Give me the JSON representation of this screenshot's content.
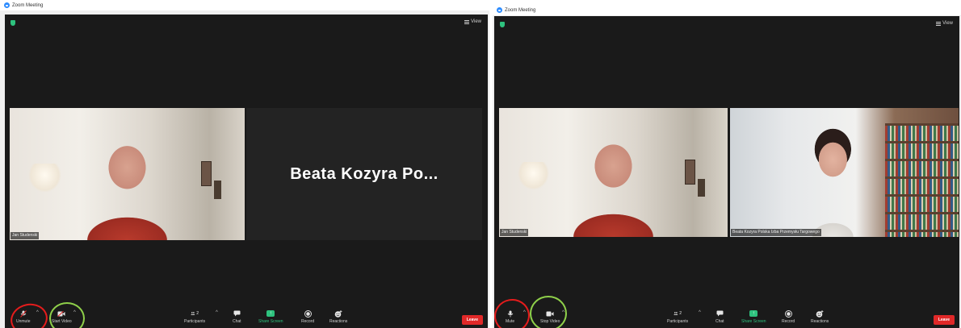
{
  "windows": [
    {
      "title": "Zoom Meeting",
      "view_label": "View",
      "tiles": [
        {
          "type": "video",
          "person": "jan",
          "name": "Jan Studenski"
        },
        {
          "type": "name-only",
          "name": "Beata Kozyra Po..."
        }
      ],
      "toolbar": {
        "mute": "Unmute",
        "video": "Start Video",
        "participants": "Participants",
        "participants_count": "2",
        "chat": "Chat",
        "share": "Share Screen",
        "record": "Record",
        "reactions": "Reactions",
        "leave": "Leave"
      }
    },
    {
      "title": "Zoom Meeting",
      "view_label": "View",
      "tiles": [
        {
          "type": "video",
          "person": "jan",
          "name": "Jan Studenski"
        },
        {
          "type": "video",
          "person": "beata",
          "name": "Beata Kozyra Polska Izba Przemysłu Targowego"
        }
      ],
      "toolbar": {
        "mute": "Mute",
        "video": "Stop Video",
        "participants": "Participants",
        "participants_count": "2",
        "chat": "Chat",
        "share": "Share Screen",
        "record": "Record",
        "reactions": "Reactions",
        "leave": "Leave"
      }
    }
  ],
  "colors": {
    "meeting_bg": "#1a1a1a",
    "leave": "#e02828",
    "share_green": "#2ec27e",
    "highlight_red": "#e51c1c",
    "highlight_green": "#8fd04a"
  },
  "icons": [
    "shield-icon",
    "grid-icon",
    "microphone-icon",
    "camera-icon",
    "participants-icon",
    "chat-icon",
    "share-screen-icon",
    "record-icon",
    "reactions-icon"
  ]
}
